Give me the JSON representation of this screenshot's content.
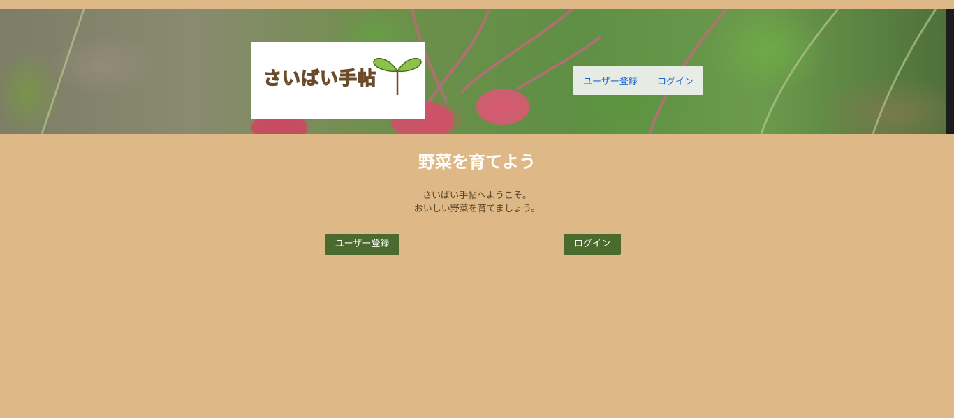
{
  "header": {
    "logo_text": "さいばい手帖",
    "nav": {
      "register_label": "ユーザー登録",
      "login_label": "ログイン"
    }
  },
  "main": {
    "title": "野菜を育てよう",
    "welcome_line1": "さいばい手帖へようこそ。",
    "welcome_line2": "おいしい野菜を育てましょう。",
    "register_button": "ユーザー登録",
    "login_button": "ログイン"
  },
  "colors": {
    "page_background": "#deb887",
    "button_background": "#4b6a2d",
    "link_color": "#1a66d6",
    "logo_text_outline": "#6b4a2a",
    "sprout_leaf": "#8bc34a"
  },
  "icons": {
    "logo_mark": "sprout-icon"
  }
}
